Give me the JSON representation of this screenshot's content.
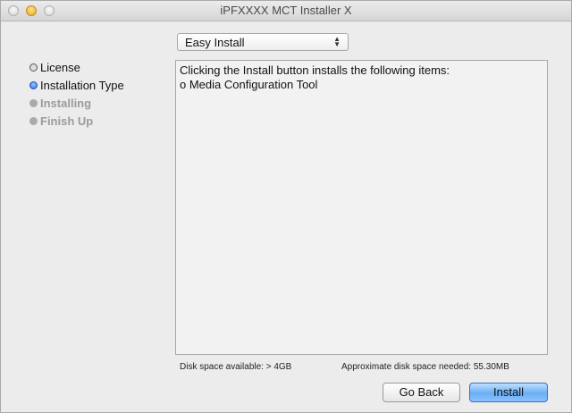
{
  "window": {
    "title": "iPFXXXX MCT Installer X"
  },
  "install_type_select": {
    "value": "Easy Install",
    "arrows_icon": "up-down-chevron-icon"
  },
  "steps": [
    {
      "label": "License",
      "state": "done"
    },
    {
      "label": "Installation Type",
      "state": "current"
    },
    {
      "label": "Installing",
      "state": "pending"
    },
    {
      "label": "Finish Up",
      "state": "pending"
    }
  ],
  "content": {
    "lines": [
      "Clicking the Install button installs the following items:",
      "o Media Configuration Tool"
    ]
  },
  "disk": {
    "available": "Disk space available: > 4GB",
    "needed": "Approximate disk space needed: 55.30MB"
  },
  "buttons": {
    "back": "Go Back",
    "install": "Install"
  },
  "colors": {
    "accent": "#2a6fe0",
    "install_button": "#6aaef5"
  }
}
